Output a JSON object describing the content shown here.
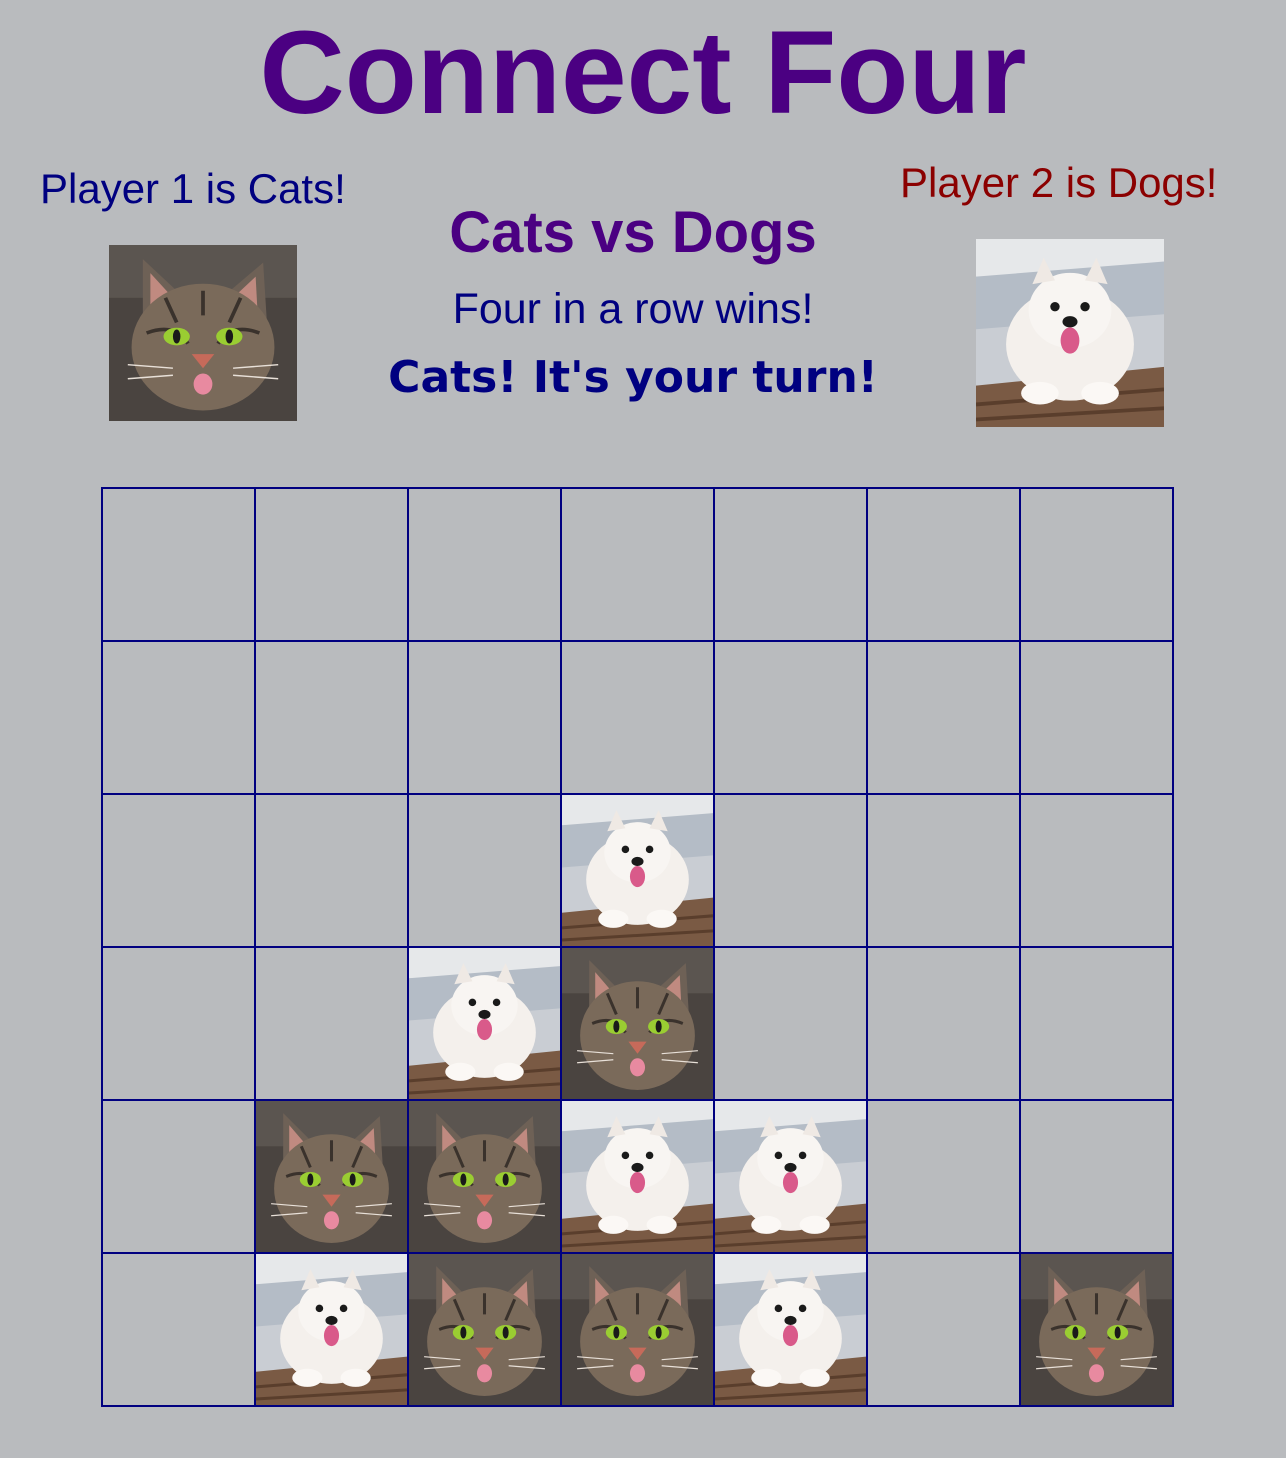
{
  "title": "Connect Four",
  "player1": {
    "label": "Player 1 is Cats!",
    "avatar_icon": "cat-icon",
    "color": "#000080"
  },
  "player2": {
    "label": "Player 2 is Dogs!",
    "avatar_icon": "dog-icon",
    "color": "#8b0000"
  },
  "subtitle": "Cats vs Dogs",
  "rule": "Four in a row wins!",
  "status": "Cats! It's your turn!",
  "colors": {
    "background": "#b9bbbe",
    "title": "#4b0082",
    "grid": "#000080"
  },
  "board": {
    "columns": 7,
    "rows": 6,
    "cells": [
      [
        "",
        "",
        "",
        "",
        "",
        "",
        ""
      ],
      [
        "",
        "",
        "",
        "",
        "",
        "",
        ""
      ],
      [
        "",
        "",
        "",
        "dog",
        "",
        "",
        ""
      ],
      [
        "",
        "",
        "dog",
        "cat",
        "",
        "",
        ""
      ],
      [
        "",
        "cat",
        "cat",
        "dog",
        "dog",
        "",
        ""
      ],
      [
        "",
        "dog",
        "cat",
        "cat",
        "dog",
        "",
        "cat"
      ]
    ]
  }
}
